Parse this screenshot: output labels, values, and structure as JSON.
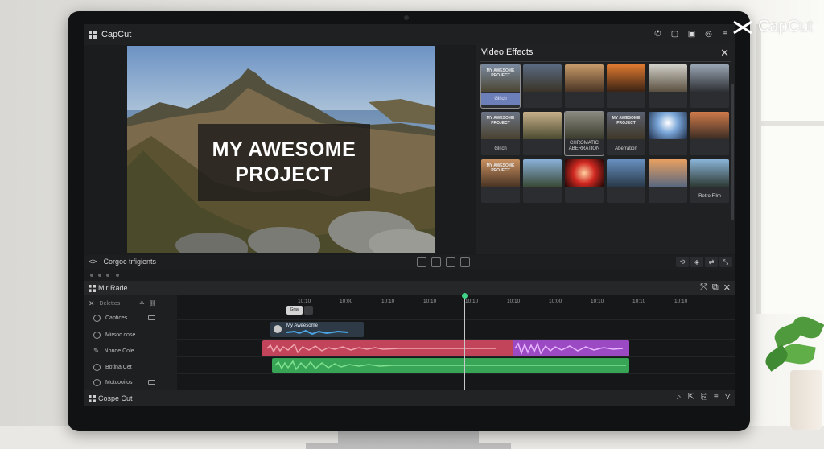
{
  "app": {
    "title": "CapCut"
  },
  "watermark": {
    "text": "CapCut"
  },
  "titlebar_icons": [
    "phone-icon",
    "square-icon",
    "save-icon",
    "settings-icon",
    "menu-icon"
  ],
  "preview": {
    "title_lines": [
      "MY AWESOME",
      "PROJECT"
    ]
  },
  "effects": {
    "title": "Video Effects",
    "rows": [
      [
        {
          "caption": "MY AWESOME PROJECT",
          "label": "",
          "badge": "Glitch"
        },
        {
          "caption": "",
          "label": ""
        },
        {
          "caption": "",
          "label": ""
        },
        {
          "caption": "",
          "label": ""
        },
        {
          "caption": "",
          "label": ""
        },
        {
          "caption": "",
          "label": ""
        }
      ],
      [
        {
          "caption": "MY AWESOME PROJECT",
          "label": "Glitch"
        },
        {
          "caption": "",
          "label": ""
        },
        {
          "caption": "",
          "label": "CHROMATIC ABERRATION"
        },
        {
          "caption": "MY AWESOME PROJECT",
          "label": "Aberration"
        },
        {
          "caption": "",
          "label": ""
        },
        {
          "caption": "",
          "label": ""
        }
      ],
      [
        {
          "caption": "MY AWESOME PROJECT",
          "label": ""
        },
        {
          "caption": "",
          "label": ""
        },
        {
          "caption": "",
          "label": ""
        },
        {
          "caption": "",
          "label": ""
        },
        {
          "caption": "",
          "label": ""
        },
        {
          "caption": "",
          "label": "Retro Film"
        }
      ]
    ]
  },
  "player": {
    "label": "Corgoc trfigients"
  },
  "timeline": {
    "title": "Mir Rade",
    "ticks": [
      "10:10",
      "10:00",
      "10:10",
      "10:10",
      "10:10",
      "10:10",
      "10:00",
      "10:10",
      "10:10",
      "10:10"
    ],
    "toolbar_label": "Delettes",
    "tracks": [
      {
        "label": "Captices"
      },
      {
        "label": "Mirsoc cose"
      },
      {
        "label": "Nonde Cole"
      },
      {
        "label": "Botina Cet"
      },
      {
        "label": "Motcooilos"
      }
    ],
    "clip_tag": "Grav",
    "clip_text": "My Aweesome"
  },
  "bottom": {
    "title": "Cospe Cut"
  }
}
